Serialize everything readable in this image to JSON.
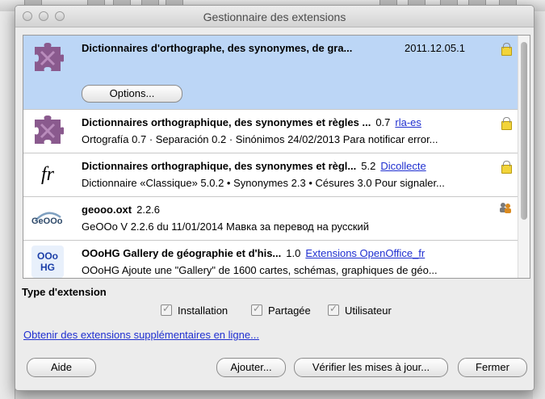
{
  "window": {
    "title": "Gestionnaire des extensions"
  },
  "extensions": [
    {
      "name": "Dictionnaires d'orthographe, des synonymes, de gra...",
      "version": "2011.12.05.1",
      "link": "",
      "description": "",
      "icon": "puzzle-piece-icon",
      "selected": true,
      "options_label": "Options..."
    },
    {
      "name": "Dictionnaires orthographique, des synonymes et règles ...",
      "version": "0.7",
      "link": "rla-es",
      "description": "Ortografía 0.7 · Separación 0.2 · Sinónimos 24/02/2013   Para notificar error...",
      "icon": "puzzle-piece-icon"
    },
    {
      "name": "Dictionnaires orthographique, des synonymes et règl...",
      "version": "5.2",
      "link": "Dicollecte",
      "description": "Dictionnaire «Classique» 5.0.2 • Synonymes 2.3 • Césures 3.0   Pour signaler...",
      "icon": "fr-logo-icon",
      "icon_text": "fr"
    },
    {
      "name": "geooo.oxt",
      "version": "2.2.6",
      "link": "",
      "description": "GeOOo V 2.2.6 du 11/01/2014  Мавка за перевод на русский",
      "icon": "geooo-logo-icon",
      "icon_text": "GeOOo"
    },
    {
      "name": "OOoHG Gallery de géographie et d'his...",
      "version": "1.0",
      "link": "Extensions OpenOffice_fr",
      "description": "OOoHG    Ajoute une \"Gallery\" de   1600 cartes, schémas, graphiques de géo...",
      "icon": "ooohg-logo-icon",
      "icon_text_1": "OOo",
      "icon_text_2": "HG"
    }
  ],
  "filter": {
    "title": "Type d'extension",
    "installation": "Installation",
    "shared": "Partagée",
    "user": "Utilisateur"
  },
  "more_link": "Obtenir des extensions supplémentaires en ligne...",
  "buttons": {
    "help": "Aide",
    "add": "Ajouter...",
    "check_updates": "Vérifier les mises à jour...",
    "close": "Fermer"
  },
  "colors": {
    "selection": "#bcd6f6",
    "link": "#1f2fd0",
    "puzzle": "#8a5a8e"
  }
}
